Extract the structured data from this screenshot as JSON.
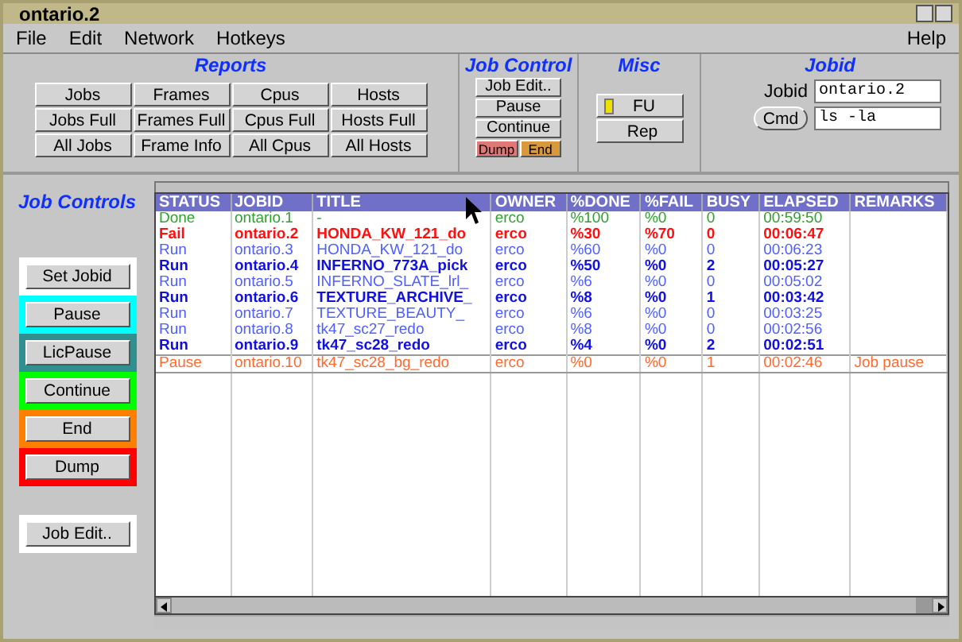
{
  "window": {
    "title": "ontario.2"
  },
  "menu": [
    "File",
    "Edit",
    "Network",
    "Hotkeys"
  ],
  "help_menu": "Help",
  "reports": {
    "title": "Reports",
    "buttons": [
      "Jobs",
      "Frames",
      "Cpus",
      "Hosts",
      "Jobs Full",
      "Frames Full",
      "Cpus Full",
      "Hosts Full",
      "All Jobs",
      "Frame Info",
      "All Cpus",
      "All Hosts"
    ]
  },
  "job_control": {
    "title": "Job Control",
    "buttons": [
      "Job Edit..",
      "Pause",
      "Continue"
    ],
    "small_buttons": [
      {
        "label": "Dump",
        "color": "#e07878"
      },
      {
        "label": "End",
        "color": "#d8983c"
      }
    ]
  },
  "misc": {
    "title": "Misc",
    "buttons": [
      {
        "label": "FU",
        "indicator": true
      },
      {
        "label": "Rep",
        "indicator": false
      }
    ]
  },
  "jobid": {
    "title": "Jobid",
    "label": "Jobid",
    "value": "ontario.2",
    "cmd_button": "Cmd",
    "cmd_value": "ls -la"
  },
  "job_controls": {
    "title": "Job Controls",
    "buttons": [
      {
        "label": "Set Jobid",
        "color": "#ffffff"
      },
      {
        "label": "Pause",
        "color": "#00ffff"
      },
      {
        "label": "LicPause",
        "color": "#309090"
      },
      {
        "label": "Continue",
        "color": "#00ff00"
      },
      {
        "label": "End",
        "color": "#ff8000"
      },
      {
        "label": "Dump",
        "color": "#ff0000"
      },
      {
        "label": "Job Edit..",
        "color": "#ffffff",
        "gap": true
      }
    ]
  },
  "table": {
    "columns": [
      "STATUS",
      "JOBID",
      "TITLE",
      "OWNER",
      "%DONE",
      "%FAIL",
      "BUSY",
      "ELAPSED",
      "REMARKS"
    ],
    "rows": [
      {
        "kind": "done",
        "selected": false,
        "cells": [
          "Done",
          "ontario.1",
          "-",
          "erco",
          "%100",
          "%0",
          "0",
          "00:59:50",
          ""
        ]
      },
      {
        "kind": "fail",
        "selected": false,
        "cells": [
          "Fail",
          "ontario.2",
          "HONDA_KW_121_do",
          "erco",
          "%30",
          "%70",
          "0",
          "00:06:47",
          ""
        ]
      },
      {
        "kind": "run",
        "selected": false,
        "cells": [
          "Run",
          "ontario.3",
          "HONDA_KW_121_do",
          "erco",
          "%60",
          "%0",
          "0",
          "00:06:23",
          ""
        ]
      },
      {
        "kind": "active",
        "selected": false,
        "cells": [
          "Run",
          "ontario.4",
          "INFERNO_773A_pick",
          "erco",
          "%50",
          "%0",
          "2",
          "00:05:27",
          ""
        ]
      },
      {
        "kind": "run",
        "selected": false,
        "cells": [
          "Run",
          "ontario.5",
          "INFERNO_SLATE_lrl_",
          "erco",
          "%6",
          "%0",
          "0",
          "00:05:02",
          ""
        ]
      },
      {
        "kind": "active",
        "selected": false,
        "cells": [
          "Run",
          "ontario.6",
          "TEXTURE_ARCHIVE_",
          "erco",
          "%8",
          "%0",
          "1",
          "00:03:42",
          ""
        ]
      },
      {
        "kind": "run",
        "selected": false,
        "cells": [
          "Run",
          "ontario.7",
          "TEXTURE_BEAUTY_",
          "erco",
          "%6",
          "%0",
          "0",
          "00:03:25",
          ""
        ]
      },
      {
        "kind": "run",
        "selected": false,
        "cells": [
          "Run",
          "ontario.8",
          "tk47_sc27_redo",
          "erco",
          "%8",
          "%0",
          "0",
          "00:02:56",
          ""
        ]
      },
      {
        "kind": "active",
        "selected": false,
        "cells": [
          "Run",
          "ontario.9",
          "tk47_sc28_redo",
          "erco",
          "%4",
          "%0",
          "2",
          "00:02:51",
          ""
        ]
      },
      {
        "kind": "pause",
        "selected": true,
        "cells": [
          "Pause",
          "ontario.10",
          "tk47_sc28_bg_redo",
          "erco",
          "%0",
          "%0",
          "1",
          "00:02:46",
          "Job pause"
        ]
      }
    ]
  }
}
